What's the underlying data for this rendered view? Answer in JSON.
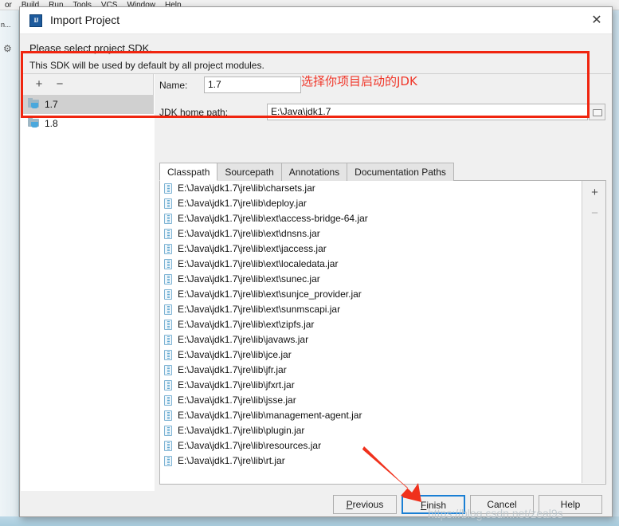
{
  "background": {
    "menu_items": [
      "or",
      "Build",
      "Run",
      "Tools",
      "VCS",
      "Window",
      "Help"
    ],
    "tool_window_label": "n...",
    "gear_icon": "gear-icon"
  },
  "dialog": {
    "title": "Import Project",
    "app_icon": "intellij-idea-icon",
    "close_icon": "close-icon",
    "heading": "Please select project SDK.",
    "subheading": "This SDK will be used by default by all project modules."
  },
  "sdk_pane": {
    "add_label": "+",
    "remove_label": "−",
    "items": [
      {
        "label": "1.7",
        "selected": true
      },
      {
        "label": "1.8",
        "selected": false
      }
    ]
  },
  "detail": {
    "name_label": "Name:",
    "name_value": "1.7",
    "home_label": "JDK home path:",
    "home_value": "E:\\Java\\jdk1.7",
    "browse_icon": "folder-browse-icon",
    "tabs": [
      {
        "label": "Classpath",
        "active": true
      },
      {
        "label": "Sourcepath",
        "active": false
      },
      {
        "label": "Annotations",
        "active": false
      },
      {
        "label": "Documentation Paths",
        "active": false
      }
    ],
    "classpath_add_label": "+",
    "classpath_remove_label": "−",
    "classpath_entries": [
      "E:\\Java\\jdk1.7\\jre\\lib\\charsets.jar",
      "E:\\Java\\jdk1.7\\jre\\lib\\deploy.jar",
      "E:\\Java\\jdk1.7\\jre\\lib\\ext\\access-bridge-64.jar",
      "E:\\Java\\jdk1.7\\jre\\lib\\ext\\dnsns.jar",
      "E:\\Java\\jdk1.7\\jre\\lib\\ext\\jaccess.jar",
      "E:\\Java\\jdk1.7\\jre\\lib\\ext\\localedata.jar",
      "E:\\Java\\jdk1.7\\jre\\lib\\ext\\sunec.jar",
      "E:\\Java\\jdk1.7\\jre\\lib\\ext\\sunjce_provider.jar",
      "E:\\Java\\jdk1.7\\jre\\lib\\ext\\sunmscapi.jar",
      "E:\\Java\\jdk1.7\\jre\\lib\\ext\\zipfs.jar",
      "E:\\Java\\jdk1.7\\jre\\lib\\javaws.jar",
      "E:\\Java\\jdk1.7\\jre\\lib\\jce.jar",
      "E:\\Java\\jdk1.7\\jre\\lib\\jfr.jar",
      "E:\\Java\\jdk1.7\\jre\\lib\\jfxrt.jar",
      "E:\\Java\\jdk1.7\\jre\\lib\\jsse.jar",
      "E:\\Java\\jdk1.7\\jre\\lib\\management-agent.jar",
      "E:\\Java\\jdk1.7\\jre\\lib\\plugin.jar",
      "E:\\Java\\jdk1.7\\jre\\lib\\resources.jar",
      "E:\\Java\\jdk1.7\\jre\\lib\\rt.jar"
    ]
  },
  "footer": {
    "previous": "Previous",
    "previous_mnemonic": "P",
    "finish": "Finish",
    "finish_mnemonic": "F",
    "cancel": "Cancel",
    "help": "Help",
    "focused_button": "Finish"
  },
  "annotations": {
    "note_text": "选择你项目启动的JDK",
    "highlight_color": "#f0250f",
    "note_color": "#f0372a",
    "arrow_color": "#f0311c",
    "arrow_target": "Finish",
    "watermark": "https://blog.csdn.net/zeal9s"
  }
}
